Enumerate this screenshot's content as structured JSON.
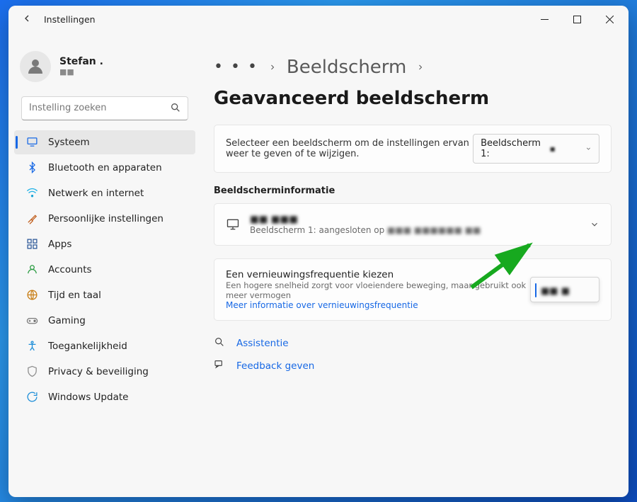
{
  "titlebar": {
    "title": "Instellingen"
  },
  "user": {
    "name": "Stefan .",
    "sub": "■■"
  },
  "search": {
    "placeholder": "Instelling zoeken"
  },
  "sidebar": {
    "items": [
      {
        "label": "Systeem",
        "icon": "monitor-icon",
        "color": "#1768e5",
        "selected": true
      },
      {
        "label": "Bluetooth en apparaten",
        "icon": "bluetooth-icon",
        "color": "#1768e5"
      },
      {
        "label": "Netwerk en internet",
        "icon": "wifi-icon",
        "color": "#1fb1e6"
      },
      {
        "label": "Persoonlijke instellingen",
        "icon": "brush-icon",
        "color": "#c05d1b"
      },
      {
        "label": "Apps",
        "icon": "apps-icon",
        "color": "#2b5797"
      },
      {
        "label": "Accounts",
        "icon": "person-icon",
        "color": "#2a9c42"
      },
      {
        "label": "Tijd en taal",
        "icon": "globe-icon",
        "color": "#c87d14"
      },
      {
        "label": "Gaming",
        "icon": "gamepad-icon",
        "color": "#7a7a7a"
      },
      {
        "label": "Toegankelijkheid",
        "icon": "accessibility-icon",
        "color": "#1b8dd8"
      },
      {
        "label": "Privacy & beveiliging",
        "icon": "shield-icon",
        "color": "#8d8d8d"
      },
      {
        "label": "Windows Update",
        "icon": "update-icon",
        "color": "#1b8dd8"
      }
    ]
  },
  "breadcrumb": {
    "prev": "Beeldscherm",
    "current": "Geavanceerd beeldscherm"
  },
  "select_display": {
    "desc": "Selecteer een beeldscherm om de instellingen ervan weer te geven of te wijzigen.",
    "value": "Beeldscherm 1:"
  },
  "info_section": "Beeldscherminformatie",
  "info_card": {
    "main": "■■ ■■■",
    "sub_prefix": "Beeldscherm 1: aangesloten op",
    "sub_blur": "■■■ ■■■■■■ ■■"
  },
  "refresh": {
    "title": "Een vernieuwingsfrequentie kiezen",
    "desc": "Een hogere snelheid zorgt voor vloeiendere beweging, maar gebruikt ook meer vermogen",
    "link": "Meer informatie over vernieuwingsfrequentie",
    "value": "■■ ■"
  },
  "aux": {
    "assist": "Assistentie",
    "feedback": "Feedback geven"
  }
}
